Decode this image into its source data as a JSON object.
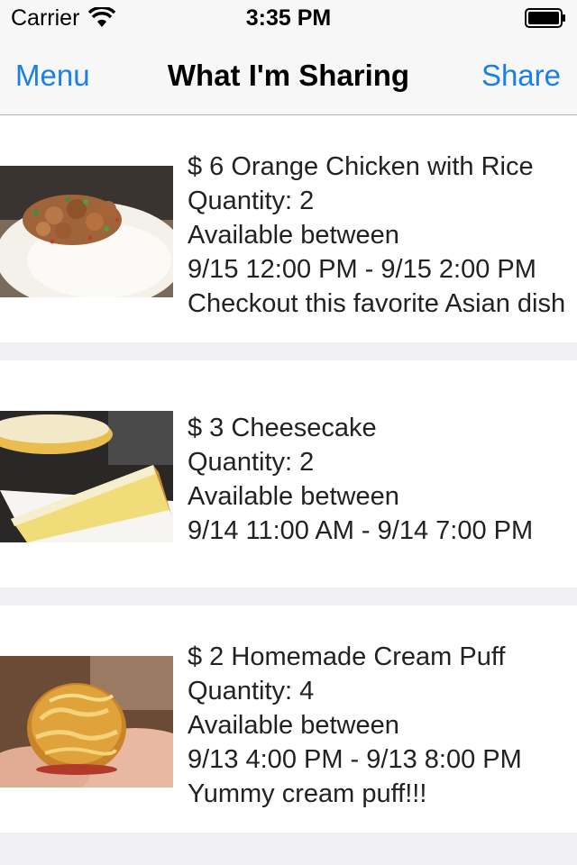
{
  "status_bar": {
    "carrier": "Carrier",
    "time": "3:35 PM"
  },
  "nav": {
    "left_label": "Menu",
    "title": "What I'm Sharing",
    "right_label": "Share",
    "tint_color": "#1a7fe8"
  },
  "items": [
    {
      "title": "$ 6 Orange Chicken with Rice",
      "quantity": "Quantity: 2",
      "available_label": "Available between",
      "time_range": "9/15 12:00 PM - 9/15 2:00 PM",
      "description": "Checkout this favorite Asian dish",
      "image": "orange-chicken-photo"
    },
    {
      "title": "$ 3 Cheesecake",
      "quantity": "Quantity: 2",
      "available_label": "Available between",
      "time_range": "9/14 11:00 AM - 9/14 7:00 PM",
      "description": "",
      "image": "cheesecake-photo"
    },
    {
      "title": "$ 2 Homemade Cream Puff",
      "quantity": "Quantity: 4",
      "available_label": "Available between",
      "time_range": "9/13 4:00 PM - 9/13 8:00 PM",
      "description": "Yummy cream puff!!!",
      "image": "cream-puff-photo"
    }
  ]
}
